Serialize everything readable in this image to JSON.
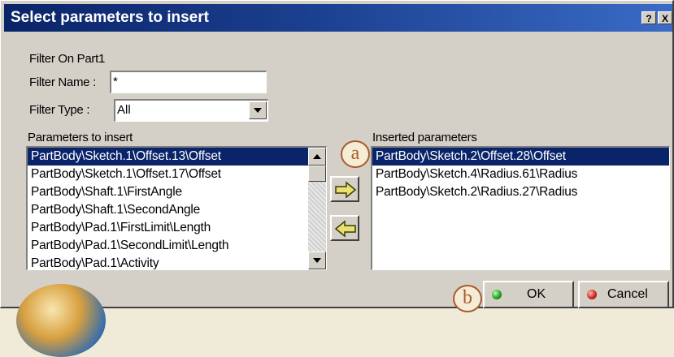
{
  "dialog": {
    "title": "Select parameters to insert",
    "help_glyph": "?",
    "close_glyph": "X"
  },
  "filter": {
    "on_part_label": "Filter On Part1",
    "name_label": "Filter Name :",
    "name_value": "*",
    "type_label": "Filter Type :",
    "type_value": "All"
  },
  "parameters_to_insert": {
    "label": "Parameters to insert",
    "items": [
      "PartBody\\Sketch.1\\Offset.13\\Offset",
      "PartBody\\Sketch.1\\Offset.17\\Offset",
      "PartBody\\Shaft.1\\FirstAngle",
      "PartBody\\Shaft.1\\SecondAngle",
      "PartBody\\Pad.1\\FirstLimit\\Length",
      "PartBody\\Pad.1\\SecondLimit\\Length",
      "PartBody\\Pad.1\\Activity"
    ],
    "selected_index": 0
  },
  "inserted_parameters": {
    "label": "Inserted parameters",
    "items": [
      "PartBody\\Sketch.2\\Offset.28\\Offset",
      "PartBody\\Sketch.4\\Radius.61\\Radius",
      "PartBody\\Sketch.2\\Radius.27\\Radius"
    ],
    "selected_index": 0
  },
  "callouts": {
    "a": "a",
    "b": "b"
  },
  "buttons": {
    "ok_label": "OK",
    "cancel_label": "Cancel"
  },
  "icons": {
    "add": "right-arrow-icon",
    "remove": "left-arrow-icon",
    "ok": "green-led-icon",
    "cancel": "red-led-icon"
  },
  "colors": {
    "title_bar": "#0a2468",
    "selection": "#0a246a",
    "dialog_face": "#d4d0c8",
    "callout": "#a85a2a",
    "arrow_fill": "#e8e070"
  }
}
